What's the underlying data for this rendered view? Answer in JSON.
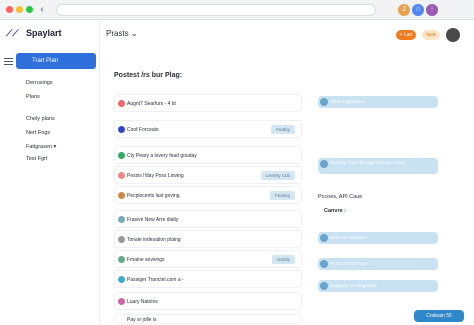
{
  "browser": {
    "back": "‹",
    "icon1": "J",
    "icon2": "☆",
    "icon3": "⋮"
  },
  "app": {
    "name": "Spaylart"
  },
  "sidebar": {
    "start_plan": "Trart Plan",
    "items": [
      "Derrusings",
      "Plans",
      "Chely plans",
      "Nert Fogs",
      "Fatigrasen ▾",
      "Test Fgrt"
    ]
  },
  "header": {
    "title": "Prasts ⌄",
    "btn1": "+ Lart",
    "btn2": "Iuce"
  },
  "main": {
    "section_title": "Postest /rs bur Plag:",
    "cards": [
      {
        "text": "Augnt7 Searfurs - 4 ld",
        "tag": ""
      },
      {
        "text": "Coof Forceuto",
        "tag": "Feathy"
      },
      {
        "text": "Cty Peary a levery fead gouday",
        "tag": ""
      },
      {
        "text": "Pessis I!day Poss Lioving",
        "tag": "Leverty Cub"
      },
      {
        "text": "Pecplocents last goving",
        "tag": "Feating"
      },
      {
        "text": "Frasive New Arre dialty",
        "tag": ""
      },
      {
        "text": "Tonale indesation plaing",
        "tag": ""
      },
      {
        "text": "Fmaine sevivngs",
        "tag": "Nobity"
      },
      {
        "text": "Passiger Tranctel.com a -",
        "tag": ""
      },
      {
        "text": "Luary Nations",
        "tag": ""
      },
      {
        "text": "Pay sr jolle is",
        "tag": ""
      }
    ]
  },
  "right": {
    "bubbles": [
      "Ssbrs Fypsurfons",
      "Booking /Tarel faraage lasts per rascy",
      "Dork sor taratyusn",
      "Pront of Fost Fogs",
      "Snagrery our Brigonpar"
    ],
    "label": "Pccoes, API Caue",
    "canvas_label": "Canvre :",
    "footer": "Cndoain 55"
  }
}
